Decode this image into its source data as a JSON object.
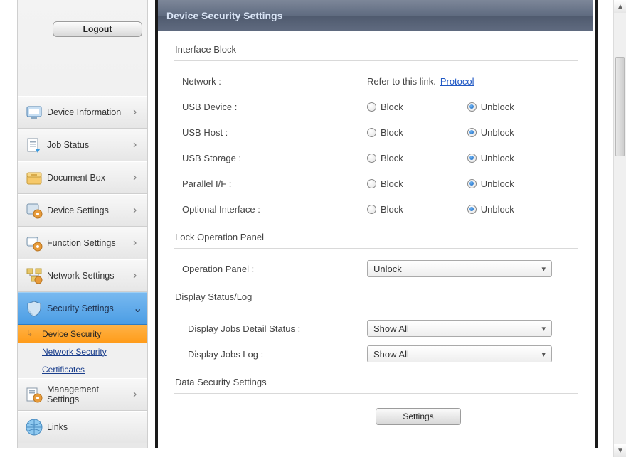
{
  "sidebar": {
    "logout_label": "Logout",
    "items": [
      {
        "label": "Device Information",
        "icon": "device-info-icon",
        "expandable": true
      },
      {
        "label": "Job Status",
        "icon": "job-status-icon",
        "expandable": true
      },
      {
        "label": "Document Box",
        "icon": "document-box-icon",
        "expandable": true
      },
      {
        "label": "Device Settings",
        "icon": "device-settings-icon",
        "expandable": true
      },
      {
        "label": "Function Settings",
        "icon": "function-settings-icon",
        "expandable": true
      },
      {
        "label": "Network Settings",
        "icon": "network-settings-icon",
        "expandable": true
      },
      {
        "label": "Security Settings",
        "icon": "security-settings-icon",
        "expandable": true,
        "active": true,
        "subitems": [
          {
            "label": "Device Security",
            "selected": true
          },
          {
            "label": "Network Security",
            "selected": false
          },
          {
            "label": "Certificates",
            "selected": false
          }
        ]
      },
      {
        "label": "Management Settings",
        "icon": "management-settings-icon",
        "expandable": true
      },
      {
        "label": "Links",
        "icon": "links-icon",
        "expandable": false
      }
    ]
  },
  "page": {
    "title": "Device Security Settings"
  },
  "sections": {
    "interface_block": {
      "title": "Interface Block",
      "network_label": "Network :",
      "network_note": "Refer to this link.",
      "network_link": "Protocol",
      "options": {
        "block": "Block",
        "unblock": "Unblock"
      },
      "rows": [
        {
          "key": "usb_device",
          "label": "USB Device :",
          "value": "Unblock"
        },
        {
          "key": "usb_host",
          "label": "USB Host :",
          "value": "Unblock"
        },
        {
          "key": "usb_storage",
          "label": "USB Storage :",
          "value": "Unblock"
        },
        {
          "key": "parallel_if",
          "label": "Parallel I/F :",
          "value": "Unblock"
        },
        {
          "key": "optional_interface",
          "label": "Optional Interface :",
          "value": "Unblock"
        }
      ]
    },
    "lock_operation_panel": {
      "title": "Lock Operation Panel",
      "row_label": "Operation Panel :",
      "value": "Unlock"
    },
    "display_status_log": {
      "title": "Display Status/Log",
      "row1_label": "Display Jobs Detail Status :",
      "row1_value": "Show All",
      "row2_label": "Display Jobs Log :",
      "row2_value": "Show All"
    },
    "data_security": {
      "title": "Data Security Settings",
      "button_label": "Settings"
    }
  },
  "colors": {
    "header_text": "#d9e4f5",
    "link": "#2058c4",
    "nav_active_bg": "#4b9de4",
    "sub_selected_bg": "#ff9c1a"
  }
}
